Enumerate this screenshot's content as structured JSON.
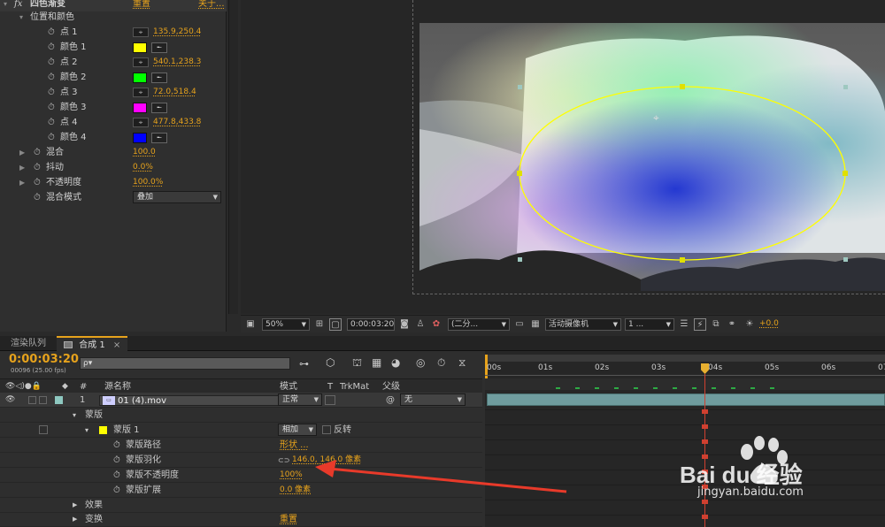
{
  "effects": {
    "fx_label": "fx",
    "effect_name": "四色渐变",
    "reset_label": "重置",
    "about_label": "关于...",
    "group_label": "位置和颜色",
    "rows": [
      {
        "label": "点 1",
        "value": "135.9,250.4"
      },
      {
        "label": "颜色 1",
        "color": "#ffff00"
      },
      {
        "label": "点 2",
        "value": "540.1,238.3"
      },
      {
        "label": "颜色 2",
        "color": "#00ff00"
      },
      {
        "label": "点 3",
        "value": "72.0,518.4"
      },
      {
        "label": "颜色 3",
        "color": "#ff00ff"
      },
      {
        "label": "点 4",
        "value": "477.8,433.8"
      },
      {
        "label": "颜色 4",
        "color": "#0000ff"
      }
    ],
    "blend_label": "混合",
    "blend_value": "100.0",
    "jitter_label": "抖动",
    "jitter_value": "0.0%",
    "opacity_label": "不透明度",
    "opacity_value": "100.0%",
    "mode_label": "混合模式",
    "mode_value": "叠加"
  },
  "viewer_toolbar": {
    "zoom": "50%",
    "timecode": "0:00:03:20",
    "resolution": "(二分...",
    "camera": "活动摄像机",
    "views": "1 ...",
    "exposure": "+0.0"
  },
  "tabs": {
    "render_queue": "渲染队列",
    "comp": "合成 1",
    "close": "×"
  },
  "timeline": {
    "timecode": "0:00:03:20",
    "frames": "00096 (25.00 fps)",
    "search_placeholder": "ρ▾",
    "col_hash": "#",
    "col_source": "源名称",
    "col_mode": "模式",
    "col_t": "T",
    "col_trkmat": "TrkMat",
    "col_parent": "父级",
    "layer_num": "1",
    "layer_name": "01 (4).mov",
    "layer_mode": "正常",
    "layer_parent": "无",
    "masks_label": "蒙版",
    "mask1_label": "蒙版 1",
    "mask1_mode": "相加",
    "invert_label": "反转",
    "mask_path_label": "蒙版路径",
    "mask_path_value": "形状 ...",
    "mask_feather_label": "蒙版羽化",
    "mask_feather_value": "146.0, 146.0 像素",
    "mask_opacity_label": "蒙版不透明度",
    "mask_opacity_value": "100%",
    "mask_expand_label": "蒙版扩展",
    "mask_expand_value": "0.0 像素",
    "effects_label": "效果",
    "transform_label": "变换",
    "transform_value": "重置",
    "ruler": [
      "00s",
      "01s",
      "02s",
      "03s",
      "04s",
      "05s",
      "06s",
      "07"
    ]
  },
  "watermark": {
    "brand": "Bai du 经验",
    "url": "jingyan.baidu.com"
  },
  "colors": {
    "accent": "#e6a21c",
    "playhead": "#e8b030",
    "ellipse": "#ffff00",
    "arrow": "#e83a2a"
  }
}
